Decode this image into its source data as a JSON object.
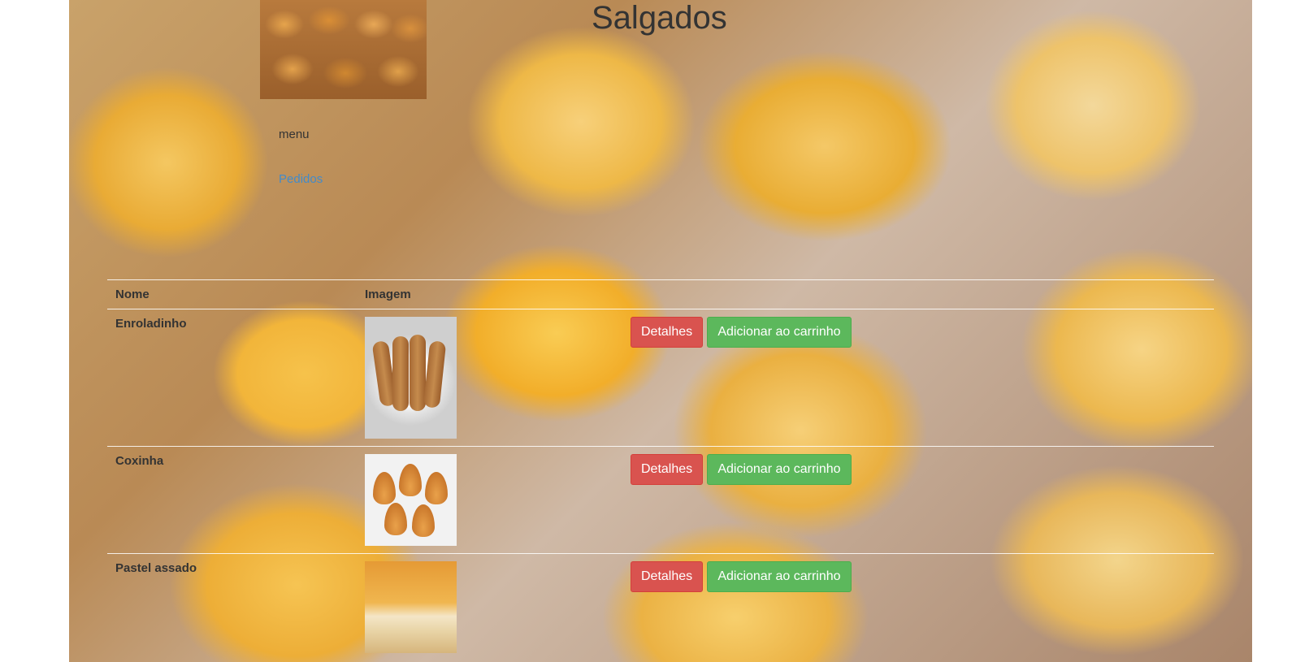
{
  "header": {
    "title": "Salgados",
    "menu_label": "menu",
    "pedidos_link": "Pedidos"
  },
  "table": {
    "headers": {
      "nome": "Nome",
      "imagem": "Imagem"
    },
    "rows": [
      {
        "nome": "Enroladinho",
        "image": "enroladinho-photo",
        "detalhes": "Detalhes",
        "adicionar": "Adicionar ao carrinho"
      },
      {
        "nome": "Coxinha",
        "image": "coxinha-photo",
        "detalhes": "Detalhes",
        "adicionar": "Adicionar ao carrinho"
      },
      {
        "nome": "Pastel assado",
        "image": "pastel-assado-photo",
        "detalhes": "Detalhes",
        "adicionar": "Adicionar ao carrinho"
      }
    ]
  },
  "colors": {
    "danger": "#d9534f",
    "success": "#5cb85c",
    "link": "#428bca",
    "text": "#333333"
  }
}
